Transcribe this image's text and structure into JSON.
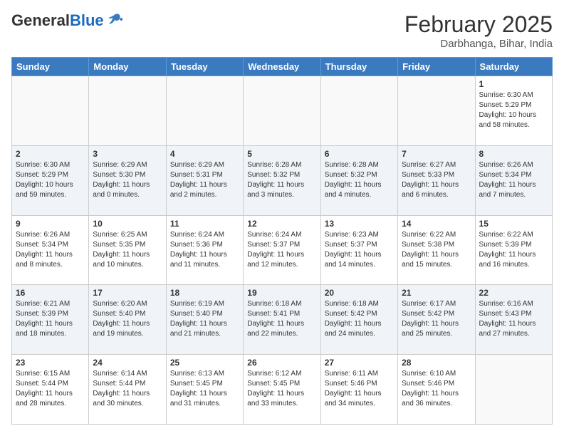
{
  "header": {
    "logo_general": "General",
    "logo_blue": "Blue",
    "month_title": "February 2025",
    "location": "Darbhanga, Bihar, India"
  },
  "weekdays": [
    "Sunday",
    "Monday",
    "Tuesday",
    "Wednesday",
    "Thursday",
    "Friday",
    "Saturday"
  ],
  "weeks": [
    [
      {
        "day": "",
        "text": ""
      },
      {
        "day": "",
        "text": ""
      },
      {
        "day": "",
        "text": ""
      },
      {
        "day": "",
        "text": ""
      },
      {
        "day": "",
        "text": ""
      },
      {
        "day": "",
        "text": ""
      },
      {
        "day": "1",
        "text": "Sunrise: 6:30 AM\nSunset: 5:29 PM\nDaylight: 10 hours\nand 58 minutes."
      }
    ],
    [
      {
        "day": "2",
        "text": "Sunrise: 6:30 AM\nSunset: 5:29 PM\nDaylight: 10 hours\nand 59 minutes."
      },
      {
        "day": "3",
        "text": "Sunrise: 6:29 AM\nSunset: 5:30 PM\nDaylight: 11 hours\nand 0 minutes."
      },
      {
        "day": "4",
        "text": "Sunrise: 6:29 AM\nSunset: 5:31 PM\nDaylight: 11 hours\nand 2 minutes."
      },
      {
        "day": "5",
        "text": "Sunrise: 6:28 AM\nSunset: 5:32 PM\nDaylight: 11 hours\nand 3 minutes."
      },
      {
        "day": "6",
        "text": "Sunrise: 6:28 AM\nSunset: 5:32 PM\nDaylight: 11 hours\nand 4 minutes."
      },
      {
        "day": "7",
        "text": "Sunrise: 6:27 AM\nSunset: 5:33 PM\nDaylight: 11 hours\nand 6 minutes."
      },
      {
        "day": "8",
        "text": "Sunrise: 6:26 AM\nSunset: 5:34 PM\nDaylight: 11 hours\nand 7 minutes."
      }
    ],
    [
      {
        "day": "9",
        "text": "Sunrise: 6:26 AM\nSunset: 5:34 PM\nDaylight: 11 hours\nand 8 minutes."
      },
      {
        "day": "10",
        "text": "Sunrise: 6:25 AM\nSunset: 5:35 PM\nDaylight: 11 hours\nand 10 minutes."
      },
      {
        "day": "11",
        "text": "Sunrise: 6:24 AM\nSunset: 5:36 PM\nDaylight: 11 hours\nand 11 minutes."
      },
      {
        "day": "12",
        "text": "Sunrise: 6:24 AM\nSunset: 5:37 PM\nDaylight: 11 hours\nand 12 minutes."
      },
      {
        "day": "13",
        "text": "Sunrise: 6:23 AM\nSunset: 5:37 PM\nDaylight: 11 hours\nand 14 minutes."
      },
      {
        "day": "14",
        "text": "Sunrise: 6:22 AM\nSunset: 5:38 PM\nDaylight: 11 hours\nand 15 minutes."
      },
      {
        "day": "15",
        "text": "Sunrise: 6:22 AM\nSunset: 5:39 PM\nDaylight: 11 hours\nand 16 minutes."
      }
    ],
    [
      {
        "day": "16",
        "text": "Sunrise: 6:21 AM\nSunset: 5:39 PM\nDaylight: 11 hours\nand 18 minutes."
      },
      {
        "day": "17",
        "text": "Sunrise: 6:20 AM\nSunset: 5:40 PM\nDaylight: 11 hours\nand 19 minutes."
      },
      {
        "day": "18",
        "text": "Sunrise: 6:19 AM\nSunset: 5:40 PM\nDaylight: 11 hours\nand 21 minutes."
      },
      {
        "day": "19",
        "text": "Sunrise: 6:18 AM\nSunset: 5:41 PM\nDaylight: 11 hours\nand 22 minutes."
      },
      {
        "day": "20",
        "text": "Sunrise: 6:18 AM\nSunset: 5:42 PM\nDaylight: 11 hours\nand 24 minutes."
      },
      {
        "day": "21",
        "text": "Sunrise: 6:17 AM\nSunset: 5:42 PM\nDaylight: 11 hours\nand 25 minutes."
      },
      {
        "day": "22",
        "text": "Sunrise: 6:16 AM\nSunset: 5:43 PM\nDaylight: 11 hours\nand 27 minutes."
      }
    ],
    [
      {
        "day": "23",
        "text": "Sunrise: 6:15 AM\nSunset: 5:44 PM\nDaylight: 11 hours\nand 28 minutes."
      },
      {
        "day": "24",
        "text": "Sunrise: 6:14 AM\nSunset: 5:44 PM\nDaylight: 11 hours\nand 30 minutes."
      },
      {
        "day": "25",
        "text": "Sunrise: 6:13 AM\nSunset: 5:45 PM\nDaylight: 11 hours\nand 31 minutes."
      },
      {
        "day": "26",
        "text": "Sunrise: 6:12 AM\nSunset: 5:45 PM\nDaylight: 11 hours\nand 33 minutes."
      },
      {
        "day": "27",
        "text": "Sunrise: 6:11 AM\nSunset: 5:46 PM\nDaylight: 11 hours\nand 34 minutes."
      },
      {
        "day": "28",
        "text": "Sunrise: 6:10 AM\nSunset: 5:46 PM\nDaylight: 11 hours\nand 36 minutes."
      },
      {
        "day": "",
        "text": ""
      }
    ]
  ]
}
